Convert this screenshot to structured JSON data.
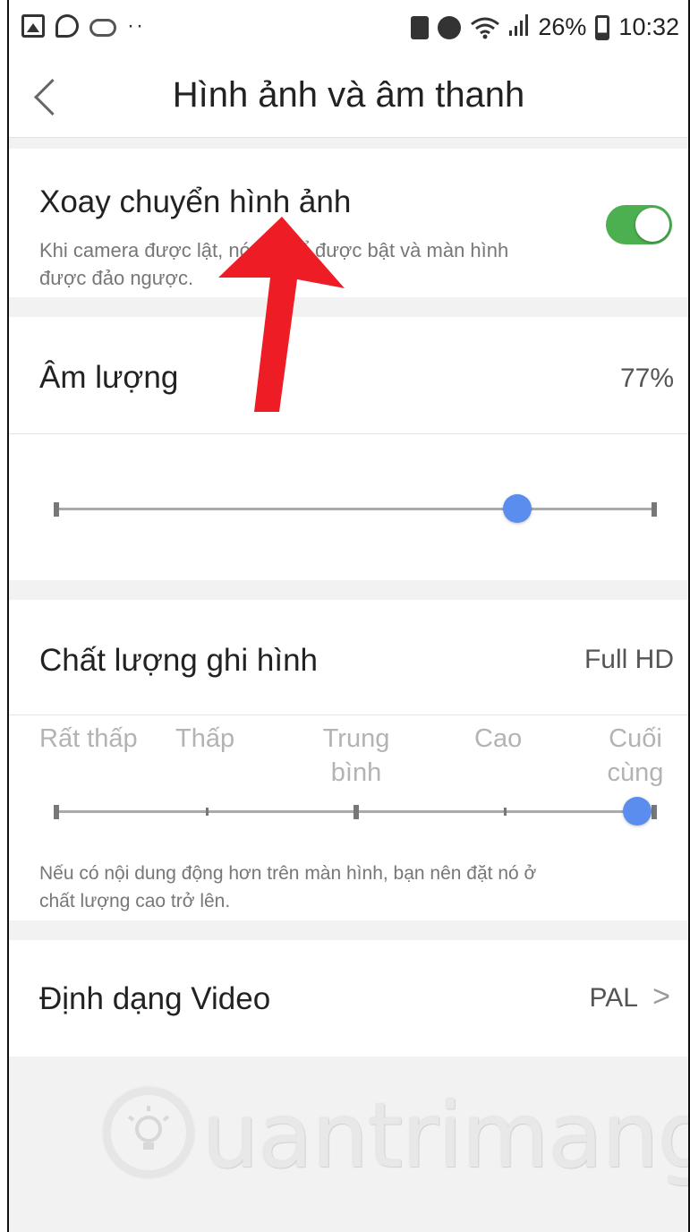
{
  "status_bar": {
    "battery_percent": "26%",
    "time": "10:32",
    "icons": [
      "gallery-icon",
      "viber-icon",
      "cloud-sync-icon",
      "more-dots-icon",
      "lock-icon",
      "alarm-icon",
      "wifi-icon",
      "signal-icon",
      "battery-icon"
    ]
  },
  "header": {
    "title": "Hình ảnh và âm thanh",
    "back_icon": "chevron-left-icon"
  },
  "rotate_setting": {
    "label": "Xoay chuyển hình ảnh",
    "description_line1": "Khi camera được lật, nó có thể được bật và màn hình",
    "description_line2": "được đảo ngược.",
    "enabled": true,
    "toggle_color": "#4caf50"
  },
  "volume_setting": {
    "label": "Âm lượng",
    "value": "77%",
    "level": 0.77,
    "thumb_color": "#5b8dee"
  },
  "quality_setting": {
    "label": "Chất lượng ghi hình",
    "value": "Full HD",
    "levels": [
      "Rất thấp",
      "Thấp",
      "Trung bình",
      "Cao",
      "Cuối cùng"
    ],
    "selected_index": 4,
    "note_line1": "Nếu có nội dung động hơn trên màn hình, bạn nên đặt nó ở",
    "note_line2": "chất lượng cao trở lên."
  },
  "video_format_setting": {
    "label": "Định dạng Video",
    "value": "PAL",
    "chevron": ">"
  },
  "annotation": {
    "arrow_color": "#ee1c24"
  },
  "watermark": {
    "text": "uantrimang",
    "logo_icon": "lightbulb-icon"
  }
}
